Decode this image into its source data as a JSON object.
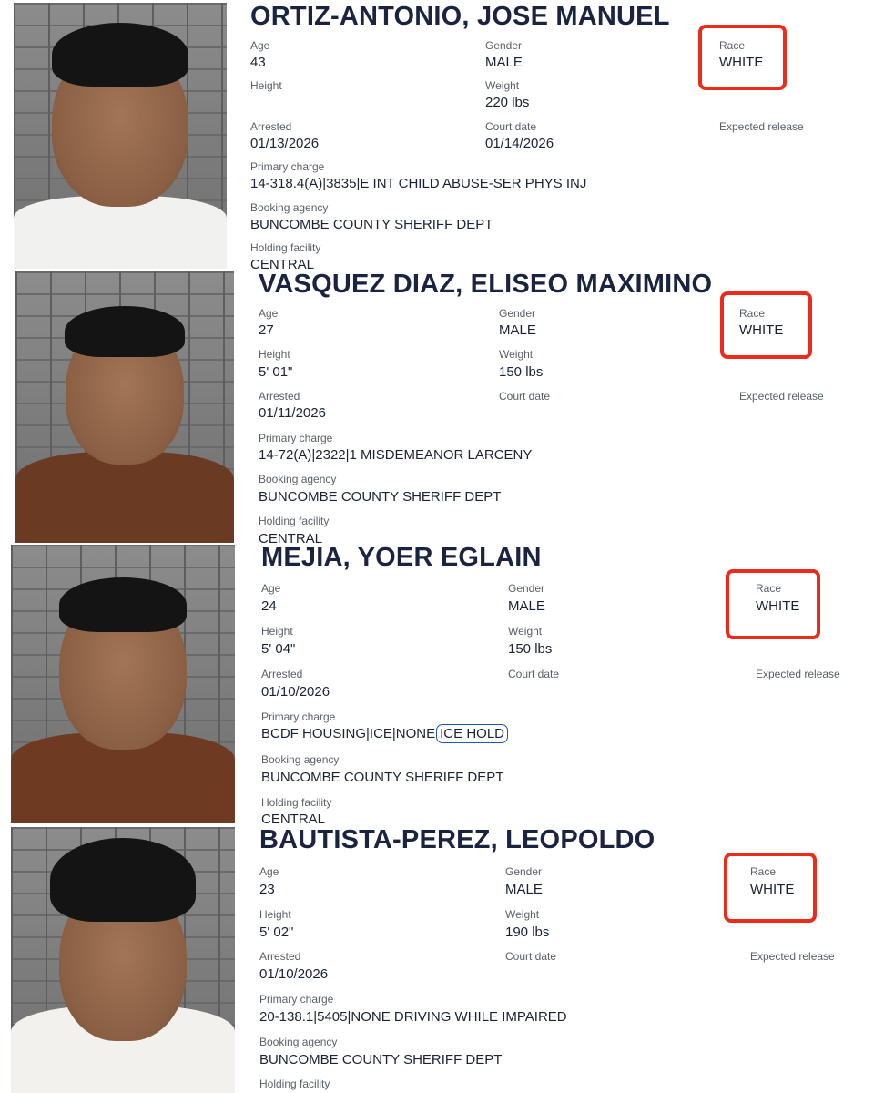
{
  "labels": {
    "age": "Age",
    "gender": "Gender",
    "race": "Race",
    "height": "Height",
    "weight": "Weight",
    "arrested": "Arrested",
    "court_date": "Court date",
    "expected_release": "Expected release",
    "primary_charge": "Primary charge",
    "booking_agency": "Booking agency",
    "holding_facility": "Holding facility"
  },
  "records": [
    {
      "name": "ORTIZ-ANTONIO, JOSE MANUEL",
      "age": "43",
      "gender": "MALE",
      "race": "WHITE",
      "height": "",
      "weight": "220 lbs",
      "arrested": "01/13/2026",
      "court_date": "01/14/2026",
      "expected_release": "",
      "primary_charge": "14-318.4(A)|3835|E INT CHILD ABUSE-SER PHYS INJ",
      "booking_agency": "BUNCOMBE COUNTY SHERIFF DEPT",
      "holding_facility": "CENTRAL"
    },
    {
      "name": "VASQUEZ DIAZ, ELISEO MAXIMINO",
      "age": "27",
      "gender": "MALE",
      "race": "WHITE",
      "height": "5' 01\"",
      "weight": "150 lbs",
      "arrested": "01/11/2026",
      "court_date": "",
      "expected_release": "",
      "primary_charge": "14-72(A)|2322|1 MISDEMEANOR LARCENY",
      "booking_agency": "BUNCOMBE COUNTY SHERIFF DEPT",
      "holding_facility": "CENTRAL"
    },
    {
      "name": "MEJIA, YOER EGLAIN",
      "age": "24",
      "gender": "MALE",
      "race": "WHITE",
      "height": "5' 04\"",
      "weight": "150 lbs",
      "arrested": "01/10/2026",
      "court_date": "",
      "expected_release": "",
      "primary_charge_prefix": "BCDF HOUSING|ICE|NONE",
      "primary_charge_highlight": "ICE HOLD",
      "booking_agency": "BUNCOMBE COUNTY SHERIFF DEPT",
      "holding_facility": "CENTRAL"
    },
    {
      "name": "BAUTISTA-PEREZ, LEOPOLDO",
      "age": "23",
      "gender": "MALE",
      "race": "WHITE",
      "height": "5' 02\"",
      "weight": "190 lbs",
      "arrested": "01/10/2026",
      "court_date": "",
      "expected_release": "",
      "primary_charge": "20-138.1|5405|NONE DRIVING WHILE IMPAIRED",
      "booking_agency": "BUNCOMBE COUNTY SHERIFF DEPT",
      "holding_facility": ""
    }
  ],
  "colors": {
    "race_highlight": "#ee2a1b",
    "ice_highlight": "#1f57b5",
    "name_text": "#1a2440"
  }
}
